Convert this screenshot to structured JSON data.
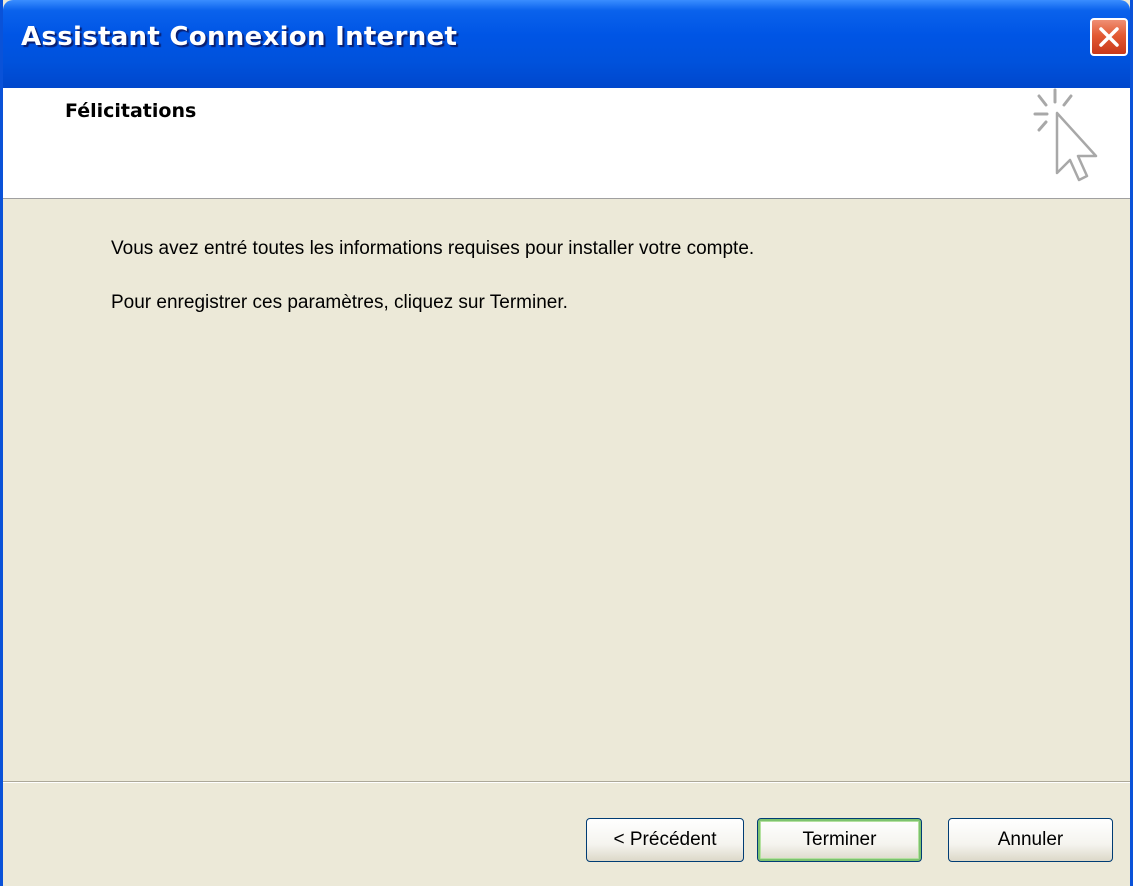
{
  "window": {
    "title": "Assistant Connexion Internet"
  },
  "header": {
    "title": "Félicitations",
    "icon": "wizard-cursor-icon"
  },
  "content": {
    "line1": "Vous avez entré toutes les informations requises pour installer votre compte.",
    "line2": "Pour enregistrer ces paramètres, cliquez sur Terminer."
  },
  "buttons": {
    "back_label": "< Précédent",
    "finish_label": "Terminer",
    "cancel_label": "Annuler"
  },
  "colors": {
    "titlebar": "#0055e5",
    "close_button": "#e35a33",
    "dialog_background": "#ece9d8",
    "default_button_focus": "#7dc26f"
  }
}
